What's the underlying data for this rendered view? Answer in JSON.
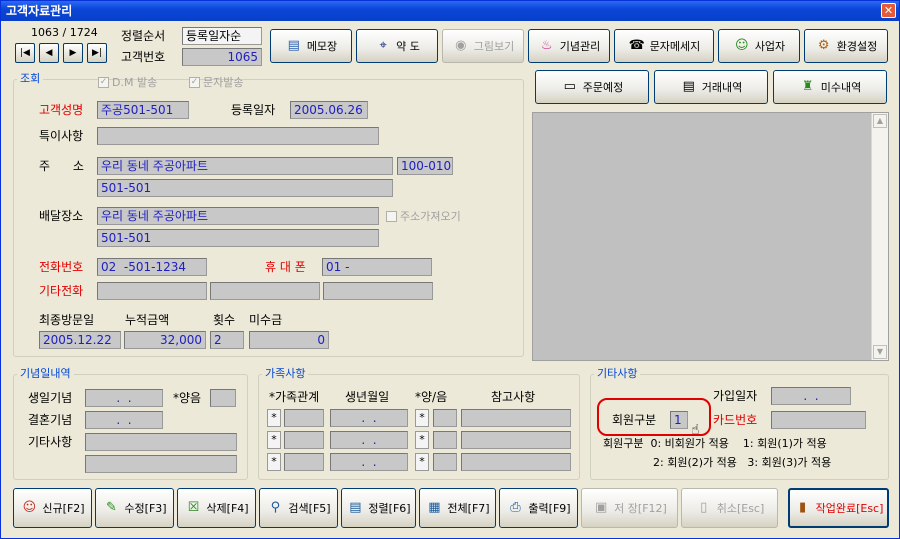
{
  "window": {
    "title": "고객자료관리",
    "close_glyph": "✕"
  },
  "nav": {
    "counter": "1063 / 1724",
    "first": "|◀",
    "prev": "◀",
    "next": "▶",
    "last": "▶|"
  },
  "sort": {
    "label": "정렬순서",
    "value": "등록일자순",
    "cust_no_label": "고객번호",
    "cust_no": "1065"
  },
  "top_buttons": [
    {
      "label": "메모장",
      "icon": "notepad-icon",
      "glyph": "▤"
    },
    {
      "label": "약 도",
      "icon": "map-icon",
      "glyph": "⌖"
    },
    {
      "label": "그림보기",
      "icon": "picture-icon",
      "glyph": "◉"
    },
    {
      "label": "기념관리",
      "icon": "cake-icon",
      "glyph": "♨"
    },
    {
      "label": "문자메세지",
      "icon": "phone-icon",
      "glyph": "☎"
    },
    {
      "label": "사업자",
      "icon": "person-icon",
      "glyph": "☺"
    },
    {
      "label": "환경설정",
      "icon": "settings-icon",
      "glyph": "⚙"
    }
  ],
  "right_buttons": [
    {
      "label": "주문예정",
      "icon": "order-icon",
      "glyph": "▭"
    },
    {
      "label": "거래내역",
      "icon": "history-icon",
      "glyph": "▤"
    },
    {
      "label": "미수내역",
      "icon": "receivable-icon",
      "glyph": "♜"
    }
  ],
  "lookup": {
    "title": "조회",
    "dm_label": "D.M 발송",
    "sms_label": "문자발송",
    "check_glyph": "✓",
    "name_label": "고객성명",
    "name": "주공501-501",
    "reg_label": "등록일자",
    "reg_date": "2005.06.26",
    "note_label": "특이사항",
    "note": "",
    "addr_label": "주      소",
    "addr1": "우리 동네 주공아파트",
    "addr_code": "100-010",
    "addr2": "501-501",
    "deliv_label": "배달장소",
    "deliv1": "우리 동네 주공아파트",
    "deliv2": "501-501",
    "copy_addr_label": "주소가져오기",
    "phone_label": "전화번호",
    "phone": "02  -501-1234",
    "mobile_label": "휴 대 폰",
    "mobile": "01 -",
    "other_phone_label": "기타전화",
    "last_visit_label": "최종방문일",
    "last_visit": "2005.12.22",
    "total_label": "누적금액",
    "total": "32,000",
    "count_label": "횟수",
    "count": "2",
    "unpaid_label": "미수금",
    "unpaid": "0"
  },
  "anniv": {
    "title": "기념일내역",
    "birthday_label": "생일기념",
    "birthday": ".  .",
    "lunar_label": "*양음",
    "wedding_label": "결혼기념",
    "wedding": ".  .",
    "other_label": "기타사항"
  },
  "family": {
    "title": "가족사항",
    "headers": [
      "*가족관계",
      "생년월일",
      "*양/음",
      "참고사항"
    ],
    "star": "*",
    "date_placeholder": ".  ."
  },
  "etc": {
    "title": "기타사항",
    "join_label": "가입일자",
    "join_date": ".  .",
    "member_label": "회원구분",
    "member_value": "1",
    "card_label": "카드번호",
    "legend1": "회원구분  0: 비회원가 적용    1: 회원(1)가 적용",
    "legend2": "2: 회원(2)가 적용   3: 회원(3)가 적용"
  },
  "bottom_buttons": [
    {
      "label": "신규[F2]",
      "icon": "new-icon",
      "glyph": "☺"
    },
    {
      "label": "수정[F3]",
      "icon": "edit-icon",
      "glyph": "✎"
    },
    {
      "label": "삭제[F4]",
      "icon": "delete-icon",
      "glyph": "☒"
    },
    {
      "label": "검색[F5]",
      "icon": "search-icon",
      "glyph": "⚲"
    },
    {
      "label": "정렬[F6]",
      "icon": "sort-icon",
      "glyph": "▤"
    },
    {
      "label": "전체[F7]",
      "icon": "all-icon",
      "glyph": "▦"
    },
    {
      "label": "출력[F9]",
      "icon": "print-icon",
      "glyph": "⎙"
    },
    {
      "label": "저 장[F12]",
      "icon": "save-icon",
      "glyph": "▣"
    },
    {
      "label": "취소[Esc]",
      "icon": "cancel-icon",
      "glyph": "▯"
    },
    {
      "label": "작업완료[Esc]",
      "icon": "exit-door-icon",
      "glyph": "▮"
    }
  ],
  "colors": {
    "accent_red": "#e00000",
    "value_blue": "#2020c0",
    "title_blue": "#0046d5"
  }
}
